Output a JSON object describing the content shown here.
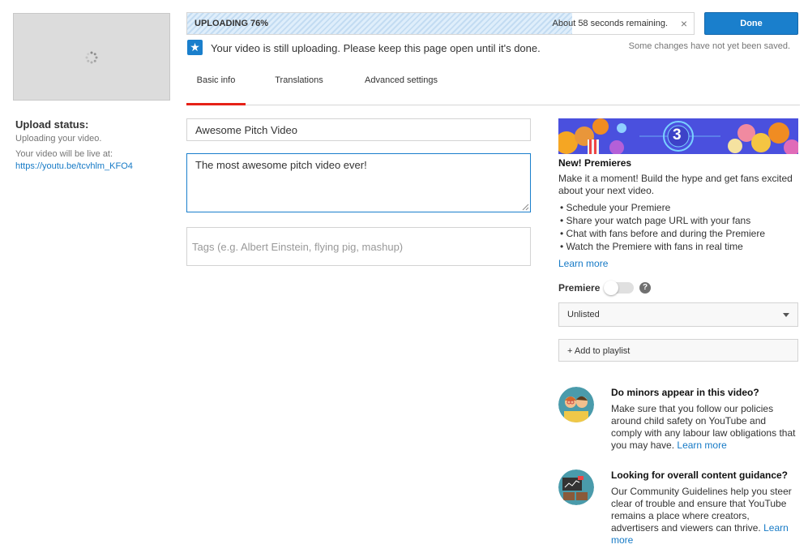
{
  "sidebar": {
    "upload_status_title": "Upload status:",
    "upload_status_text": "Uploading your video.",
    "live_text": "Your video will be live at:",
    "live_link": "https://youtu.be/tcvhlm_KFO4"
  },
  "progress": {
    "label": "UPLOADING 76%",
    "percent": 76,
    "remaining": "About 58 seconds remaining.",
    "close": "×"
  },
  "done_button": "Done",
  "notice": {
    "message": "Your video is still uploading. Please keep this page open until it's done.",
    "unsaved": "Some changes have not yet been saved."
  },
  "tabs": [
    {
      "label": "Basic info",
      "active": true
    },
    {
      "label": "Translations",
      "active": false
    },
    {
      "label": "Advanced settings",
      "active": false
    }
  ],
  "form": {
    "title_value": "Awesome Pitch Video",
    "description_value": "The most awesome pitch video ever!",
    "tags_placeholder": "Tags (e.g. Albert Einstein, flying pig, mashup)"
  },
  "premieres": {
    "banner_number": "3",
    "title": "New! Premieres",
    "body": "Make it a moment! Build the hype and get fans excited about your next video.",
    "bullets": [
      "Schedule your Premiere",
      "Share your watch page URL with your fans",
      "Chat with fans before and during the Premiere",
      "Watch the Premiere with fans in real time"
    ],
    "learn_more": "Learn more"
  },
  "premiere_toggle": {
    "label": "Premiere",
    "enabled": false,
    "help": "?"
  },
  "privacy": {
    "selected": "Unlisted"
  },
  "playlist_button": "+ Add to playlist",
  "minors": {
    "title": "Do minors appear in this video?",
    "body": "Make sure that you follow our policies around child safety on YouTube and comply with any labour law obligations that you may have.",
    "learn_more": "Learn more"
  },
  "guidance": {
    "title": "Looking for overall content guidance?",
    "body": "Our Community Guidelines help you steer clear of trouble and ensure that YouTube remains a place where creators, advertisers and viewers can thrive.",
    "learn_more": "Learn more"
  },
  "colors": {
    "accent_blue": "#1a7fcc",
    "link_blue": "#167ac6",
    "tab_active_red": "#e62117"
  }
}
